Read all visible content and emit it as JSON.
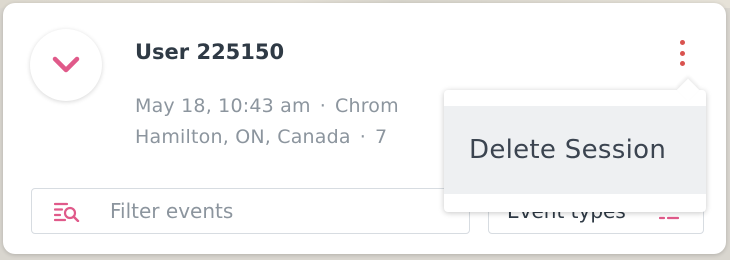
{
  "session": {
    "user": "User 225150",
    "datetime": "May 18, 10:43 am",
    "browser": "Chrom",
    "location": "Hamilton, ON, Canada",
    "extra": "7",
    "separator": "·"
  },
  "filter": {
    "placeholder": "Filter events"
  },
  "event_types": {
    "label": "Event types"
  },
  "menu": {
    "delete_label": "Delete Session"
  },
  "colors": {
    "accent": "#e05a8a",
    "kebab": "#d9534f",
    "text_primary": "#2f3a45",
    "text_muted": "#8c959e"
  },
  "icons": {
    "expand": "chevron-down-icon",
    "more": "kebab-menu-icon",
    "filter": "filter-search-icon",
    "event_types": "list-filter-icon"
  }
}
